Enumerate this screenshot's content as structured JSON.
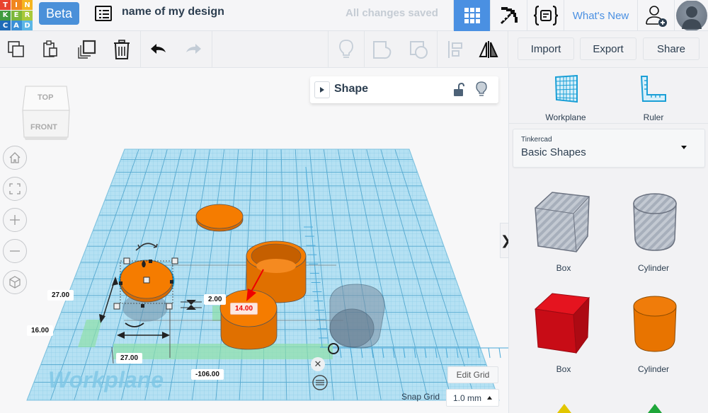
{
  "header": {
    "logo_letters": [
      "T",
      "I",
      "N",
      "K",
      "E",
      "R",
      "C",
      "A",
      "D"
    ],
    "logo_colors": [
      "#e8432e",
      "#f0861e",
      "#f5b520",
      "#3f9b3f",
      "#7cb73a",
      "#a9c93a",
      "#1f6bb8",
      "#3b8fd6",
      "#5cb6e6"
    ],
    "beta_label": "Beta",
    "design_name": "name of my design",
    "save_status": "All changes saved",
    "whats_new_label": "What's New",
    "accent": "#4a90e2"
  },
  "toolbar": {
    "import_label": "Import",
    "export_label": "Export",
    "share_label": "Share"
  },
  "viewport": {
    "viewcube": {
      "top": "TOP",
      "front": "FRONT"
    },
    "shape_panel": {
      "title": "Shape"
    },
    "dimensions": {
      "depth": "27.00",
      "position_y": "16.00",
      "width": "27.00",
      "position_x": "-106.00",
      "height": "2.00",
      "elevation": "14.00"
    },
    "workplane_watermark": "Workplane",
    "edit_grid_label": "Edit Grid",
    "snap_grid_label": "Snap Grid",
    "snap_grid_value": "1.0 mm",
    "object_color": "#f57c00"
  },
  "right_panel": {
    "tools": [
      {
        "label": "Workplane",
        "icon": "workplane-icon"
      },
      {
        "label": "Ruler",
        "icon": "ruler-icon"
      }
    ],
    "library": {
      "source": "Tinkercad",
      "category": "Basic Shapes"
    },
    "shapes": [
      {
        "label": "Box",
        "kind": "hole-box",
        "color": "#c8ccd4"
      },
      {
        "label": "Cylinder",
        "kind": "hole-cylinder",
        "color": "#c8ccd4"
      },
      {
        "label": "Box",
        "kind": "solid-box",
        "color": "#d90412"
      },
      {
        "label": "Cylinder",
        "kind": "solid-cylinder",
        "color": "#f07800"
      }
    ]
  }
}
